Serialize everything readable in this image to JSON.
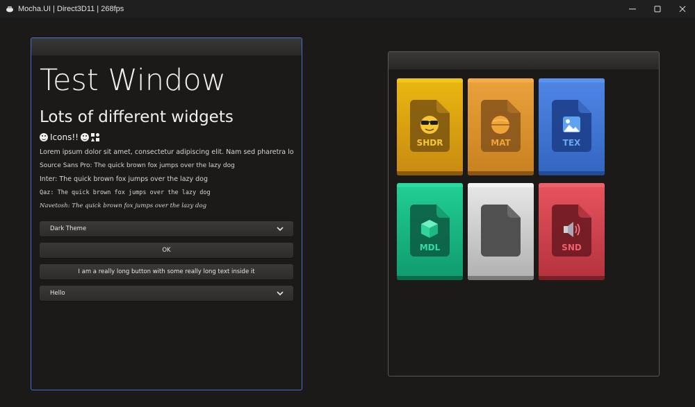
{
  "window": {
    "title": "Mocha.UI | Direct3D11 | 268fps",
    "minimize_glyph": "—",
    "maximize_glyph": "☐",
    "close_glyph": "✕"
  },
  "test_window": {
    "title": "Test Window",
    "subtitle": "Lots of different widgets",
    "icons_text": "Icons!!",
    "lorem": "Lorem ipsum dolor sit amet, consectetur adipiscing elit. Nam sed pharetra lorem. Aliqu",
    "font_samples": [
      "Source Sans Pro: The quick brown fox jumps over the lazy dog",
      "Inter: The quick brown fox jumps over the lazy dog",
      "Qaz: The quick brown fox jumps over the lazy dog",
      "Navetosh: The quick brown fox jumps over the lazy dog"
    ],
    "theme_dropdown": "Dark Theme",
    "ok_button": "OK",
    "long_button": "I am a really long button with some really long text inside it",
    "hello_dropdown": "Hello"
  },
  "assets": [
    {
      "label": "SHDR",
      "icon": "sunglasses-emoji-icon",
      "color": "#e2a90f"
    },
    {
      "label": "MAT",
      "icon": "material-sphere-icon",
      "color": "#e0962c"
    },
    {
      "label": "TEX",
      "icon": "image-icon",
      "color": "#3f74d6"
    },
    {
      "label": "MDL",
      "icon": "cube-icon",
      "color": "#17b383"
    },
    {
      "label": "",
      "icon": "blank-file-icon",
      "color": "#c6c6c6"
    },
    {
      "label": "SND",
      "icon": "speaker-icon",
      "color": "#d9434f"
    }
  ]
}
